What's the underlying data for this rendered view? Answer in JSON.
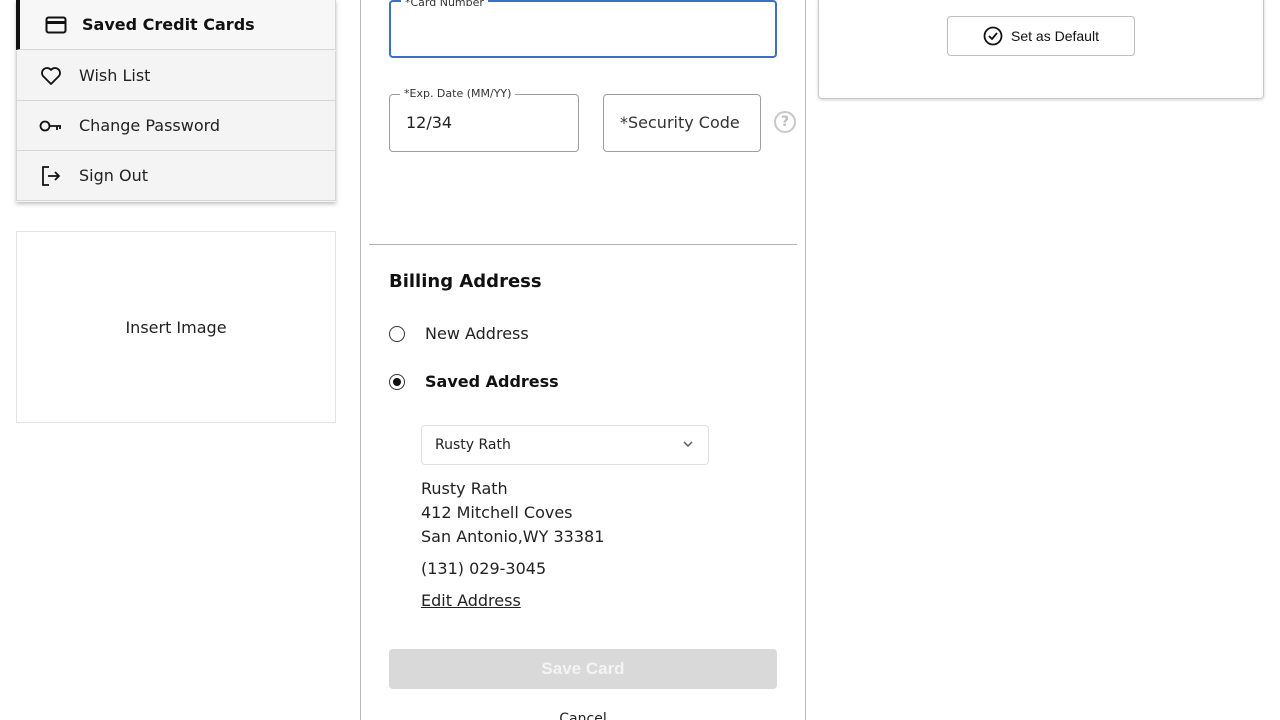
{
  "nav": {
    "items": [
      {
        "label": "Saved Credit Cards",
        "icon": "credit-card-icon"
      },
      {
        "label": "Wish List",
        "icon": "heart-icon"
      },
      {
        "label": "Change Password",
        "icon": "key-icon"
      },
      {
        "label": "Sign Out",
        "icon": "sign-out-icon"
      }
    ],
    "active_index": 0
  },
  "insert_image": {
    "label": "Insert Image"
  },
  "card_form": {
    "card_number": {
      "label": "*Card Number",
      "value": ""
    },
    "exp_date": {
      "label": "*Exp. Date (MM/YY)",
      "value": "12/34"
    },
    "security_code": {
      "placeholder": "*Security Code"
    },
    "help_icon": "?"
  },
  "billing": {
    "title": "Billing Address",
    "options": [
      {
        "label": "New Address",
        "selected": false
      },
      {
        "label": "Saved Address",
        "selected": true
      }
    ],
    "selected_address": "Rusty Rath",
    "address": {
      "name": "Rusty Rath",
      "street": "412 Mitchell Coves",
      "city_state_zip": "San Antonio,WY 33381",
      "phone": "(131) 029-3045"
    },
    "edit_label": "Edit Address"
  },
  "actions": {
    "save_label": "Save Card",
    "cancel_label": "Cancel"
  },
  "default_card": {
    "button_label": "Set as Default"
  },
  "colors": {
    "focus_border": "#3d6fc9",
    "disabled_button": "#d9d9d9"
  }
}
